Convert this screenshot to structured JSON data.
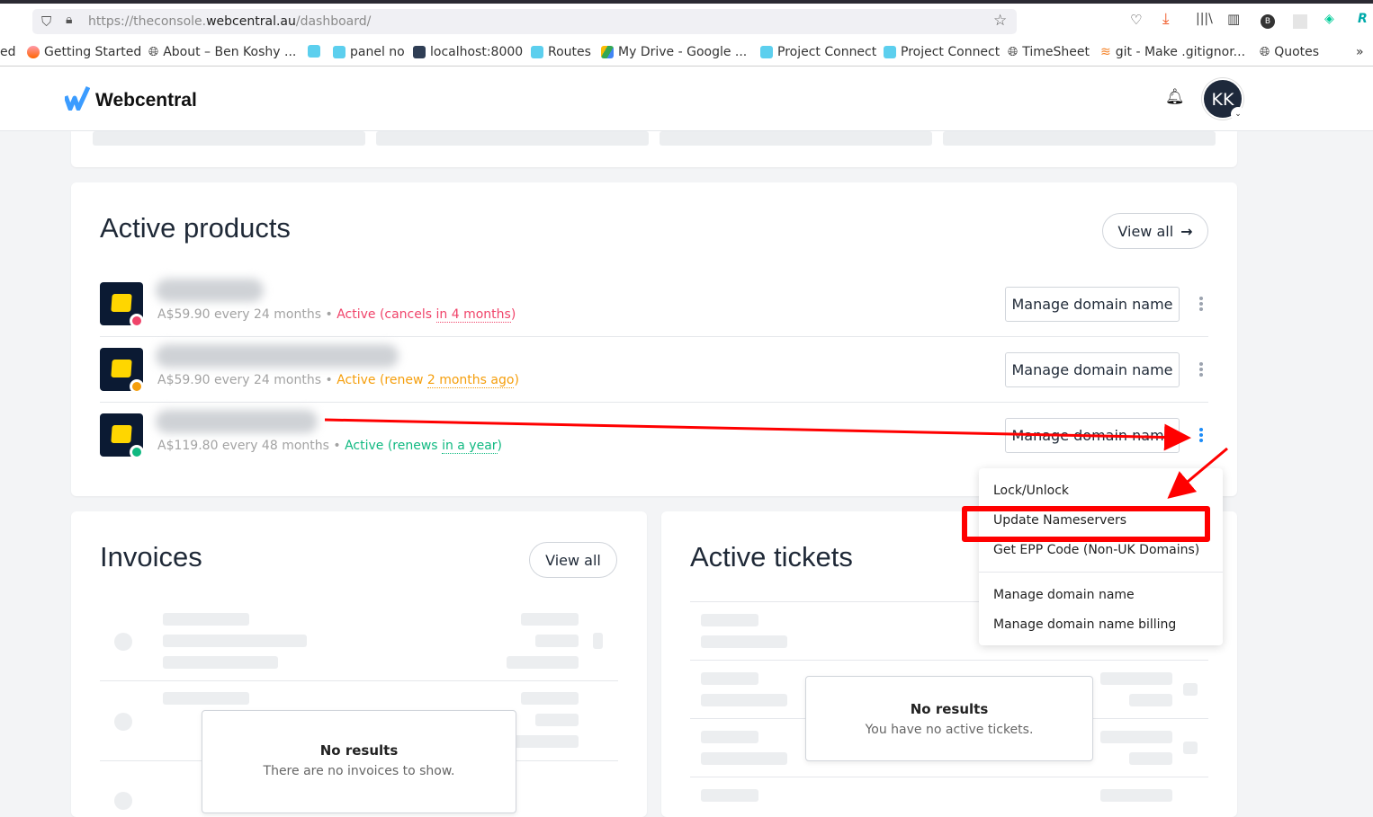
{
  "browser": {
    "url_prefix": "https://theconsole.",
    "url_domain": "webcentral.au",
    "url_path": "/dashboard/",
    "bookmarks": [
      {
        "label": "ed"
      },
      {
        "label": "Getting Started"
      },
      {
        "label": "About – Ben Koshy ..."
      },
      {
        "label": ""
      },
      {
        "label": "panel no"
      },
      {
        "label": "localhost:8000"
      },
      {
        "label": "Routes"
      },
      {
        "label": "My Drive - Google ..."
      },
      {
        "label": "Project Connect"
      },
      {
        "label": "Project Connect"
      },
      {
        "label": "TimeSheet"
      },
      {
        "label": "git - Make .gitignor..."
      },
      {
        "label": "Quotes"
      }
    ],
    "more": "»"
  },
  "header": {
    "brand": "Webcentral",
    "avatar_initials": "KK"
  },
  "active_products": {
    "title": "Active products",
    "view_all": "View all",
    "items": [
      {
        "price": "A$59.90 every 24 months",
        "sep": " • ",
        "status_prefix": "Active (cancels ",
        "status_time": "in 4 months",
        "status_suffix": ")",
        "status_color": "#f0446a",
        "manage_label": "Manage domain name"
      },
      {
        "price": "A$59.90 every 24 months",
        "sep": " • ",
        "status_prefix": "Active (renew ",
        "status_time": "2 months ago",
        "status_suffix": ")",
        "status_color": "#f59e0b",
        "manage_label": "Manage domain name"
      },
      {
        "price": "A$119.80 every 48 months",
        "sep": " • ",
        "status_prefix": "Active (renews ",
        "status_time": "in a year",
        "status_suffix": ")",
        "status_color": "#10b981",
        "manage_label": "Manage domain name"
      }
    ]
  },
  "menu": {
    "items": [
      "Lock/Unlock",
      "Update Nameservers",
      "Get EPP Code (Non-UK Domains)",
      "Manage domain name",
      "Manage domain name billing"
    ],
    "highlighted": "Update Nameservers"
  },
  "invoices": {
    "title": "Invoices",
    "view_all": "View all",
    "empty_title": "No results",
    "empty_text": "There are no invoices to show."
  },
  "tickets": {
    "title": "Active tickets",
    "empty_title": "No results",
    "empty_text": "You have no active tickets."
  },
  "colors": {
    "accent": "#1d8cf8",
    "annotation": "#ff0000",
    "brand_blue": "#3b9cff"
  }
}
